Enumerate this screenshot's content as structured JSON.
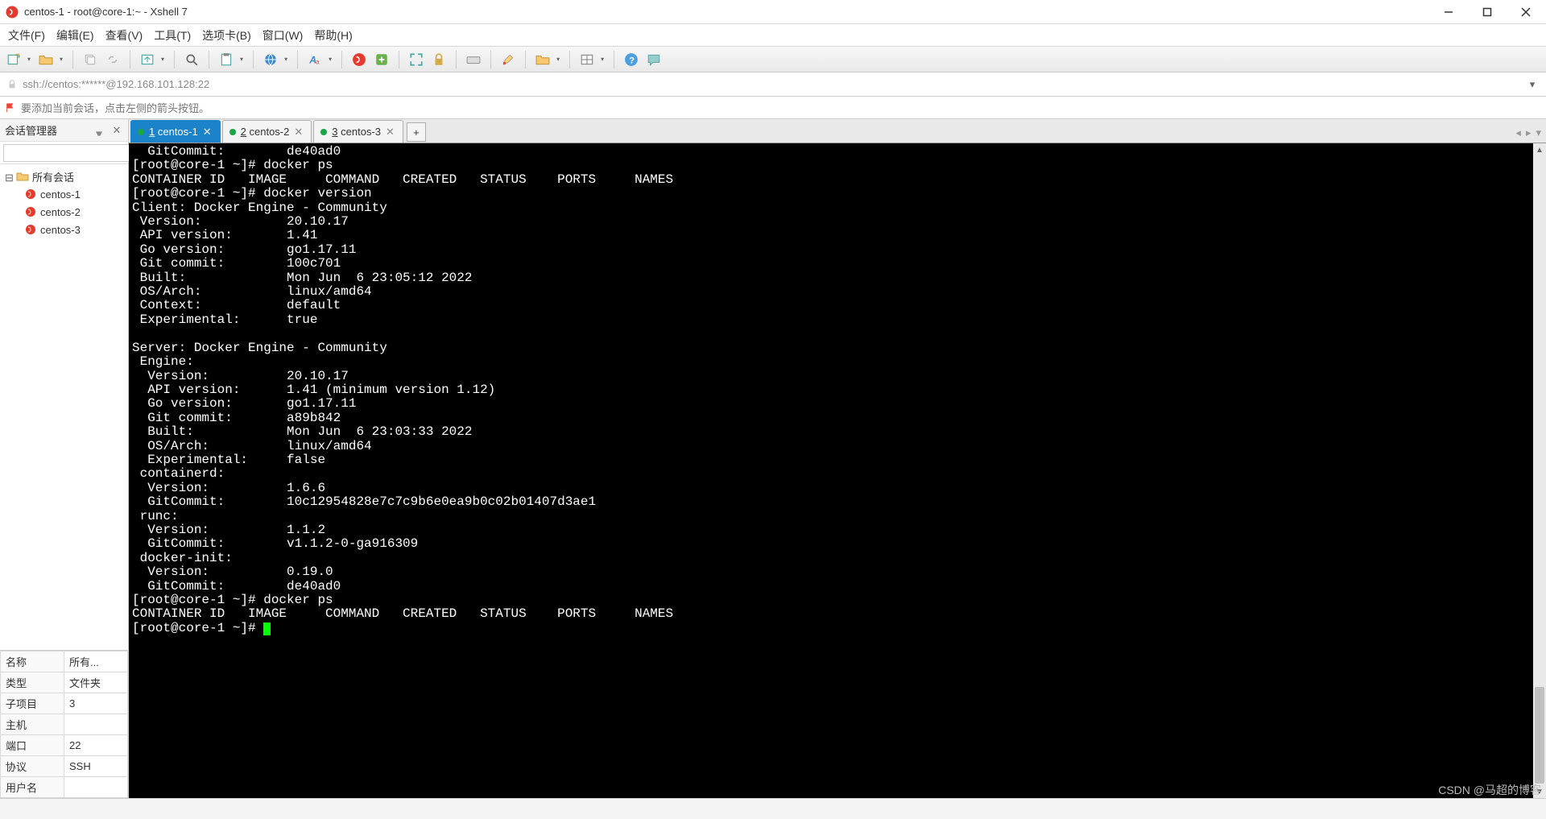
{
  "title_bar": {
    "title": "centos-1 - root@core-1:~ - Xshell 7"
  },
  "menu": {
    "file": "文件(F)",
    "edit": "编辑(E)",
    "view": "查看(V)",
    "tools": "工具(T)",
    "tab": "选项卡(B)",
    "window": "窗口(W)",
    "help": "帮助(H)"
  },
  "address": "ssh://centos:******@192.168.101.128:22",
  "hint": "要添加当前会话，点击左侧的箭头按钮。",
  "sidebar": {
    "title": "会话管理器",
    "search_placeholder": "",
    "root": "所有会话",
    "items": [
      {
        "label": "centos-1"
      },
      {
        "label": "centos-2"
      },
      {
        "label": "centos-3"
      }
    ]
  },
  "props": {
    "rows": [
      {
        "k": "名称",
        "v": "所有..."
      },
      {
        "k": "类型",
        "v": "文件夹"
      },
      {
        "k": "子项目",
        "v": "3"
      },
      {
        "k": "主机",
        "v": ""
      },
      {
        "k": "端口",
        "v": "22"
      },
      {
        "k": "协议",
        "v": "SSH"
      },
      {
        "k": "用户名",
        "v": ""
      }
    ]
  },
  "tabs": {
    "items": [
      {
        "num": "1",
        "label": "centos-1",
        "active": true
      },
      {
        "num": "2",
        "label": "centos-2",
        "active": false
      },
      {
        "num": "3",
        "label": "centos-3",
        "active": false
      }
    ],
    "add": "+"
  },
  "terminal_lines": [
    "  GitCommit:        de40ad0",
    "[root@core-1 ~]# docker ps",
    "CONTAINER ID   IMAGE     COMMAND   CREATED   STATUS    PORTS     NAMES",
    "[root@core-1 ~]# docker version",
    "Client: Docker Engine - Community",
    " Version:           20.10.17",
    " API version:       1.41",
    " Go version:        go1.17.11",
    " Git commit:        100c701",
    " Built:             Mon Jun  6 23:05:12 2022",
    " OS/Arch:           linux/amd64",
    " Context:           default",
    " Experimental:      true",
    "",
    "Server: Docker Engine - Community",
    " Engine:",
    "  Version:          20.10.17",
    "  API version:      1.41 (minimum version 1.12)",
    "  Go version:       go1.17.11",
    "  Git commit:       a89b842",
    "  Built:            Mon Jun  6 23:03:33 2022",
    "  OS/Arch:          linux/amd64",
    "  Experimental:     false",
    " containerd:",
    "  Version:          1.6.6",
    "  GitCommit:        10c12954828e7c7c9b6e0ea9b0c02b01407d3ae1",
    " runc:",
    "  Version:          1.1.2",
    "  GitCommit:        v1.1.2-0-ga916309",
    " docker-init:",
    "  Version:          0.19.0",
    "  GitCommit:        de40ad0",
    "[root@core-1 ~]# docker ps",
    "CONTAINER ID   IMAGE     COMMAND   CREATED   STATUS    PORTS     NAMES"
  ],
  "terminal_prompt": "[root@core-1 ~]# ",
  "watermark": "CSDN @马超的博客"
}
